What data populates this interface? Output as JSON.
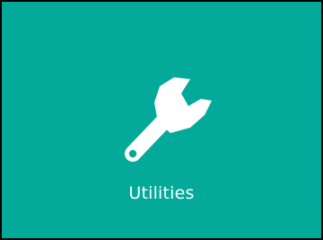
{
  "tile": {
    "label": "Utilities",
    "icon": "wrench-icon",
    "background_color": "#03aa9a",
    "border_color": "#000000",
    "icon_color": "#ffffff",
    "label_color": "#ffffff"
  }
}
